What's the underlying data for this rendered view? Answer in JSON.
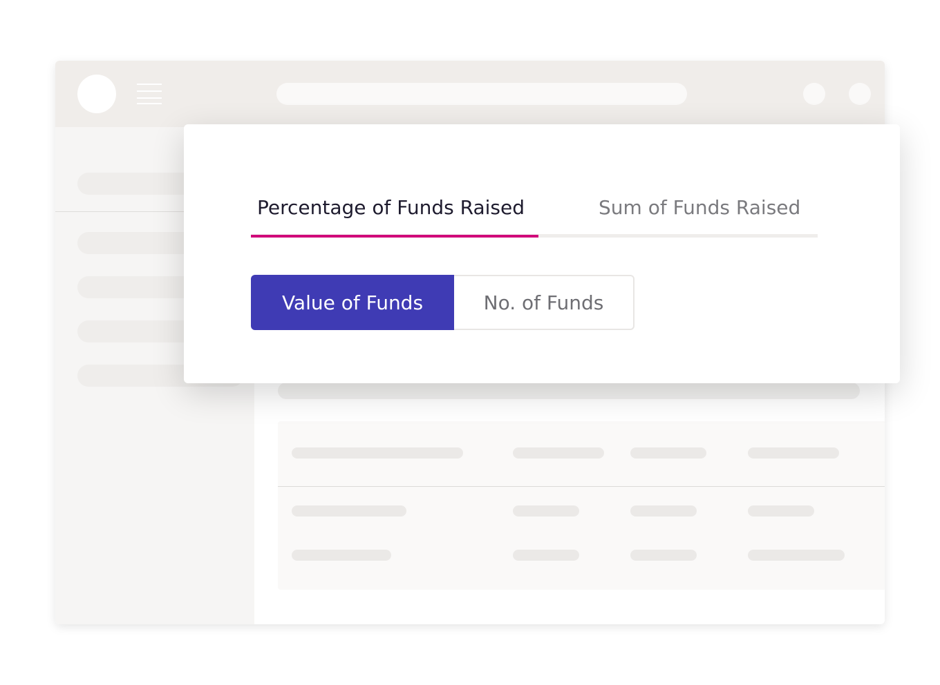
{
  "tabs": [
    {
      "label": "Percentage of Funds Raised",
      "active": true
    },
    {
      "label": "Sum of Funds Raised",
      "active": false
    }
  ],
  "toggle": [
    {
      "label": "Value of Funds",
      "active": true
    },
    {
      "label": "No. of Funds",
      "active": false
    }
  ],
  "colors": {
    "accent_underline": "#d0077a",
    "toggle_active_bg": "#3f3bb4",
    "placeholder_gray": "#f0edea"
  }
}
